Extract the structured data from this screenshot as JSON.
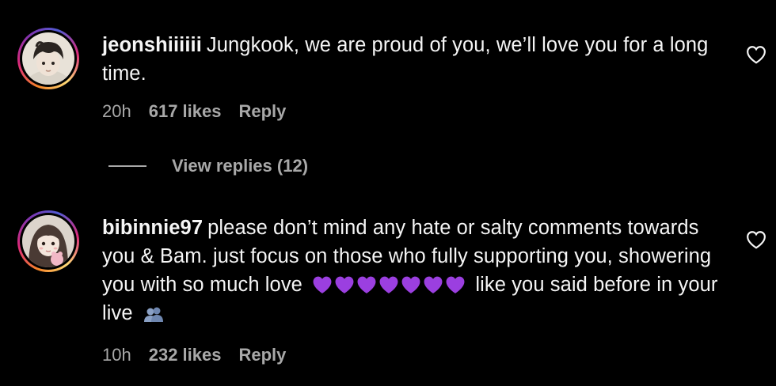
{
  "comments": [
    {
      "username": "jeonshiiiiii",
      "text": "Jungkook, we are proud of you, we’ll love you for a long time.",
      "time": "20h",
      "likes": "617 likes",
      "reply_label": "Reply",
      "avatar": "avatar-image-boy",
      "like_icon": "heart-outline-icon"
    },
    {
      "username": "bibinnie97",
      "text_before_emoji": "please don’t mind any hate or salty comments towards you & Bam. just focus on those who fully supporting you, showering you with so much love",
      "emoji_hearts": "💜💜💜💜💜💜💜",
      "text_after_emoji": "like you said before in your live",
      "trailing_emoji": "👥",
      "time": "10h",
      "likes": "232 likes",
      "reply_label": "Reply",
      "avatar": "avatar-image-girl",
      "like_icon": "heart-outline-icon"
    }
  ],
  "view_replies": {
    "label": "View replies (12)"
  },
  "colors": {
    "background": "#000000",
    "text": "#f5f5f5",
    "secondary": "#a8a8a8",
    "purple_heart": "#9b3fe0"
  }
}
